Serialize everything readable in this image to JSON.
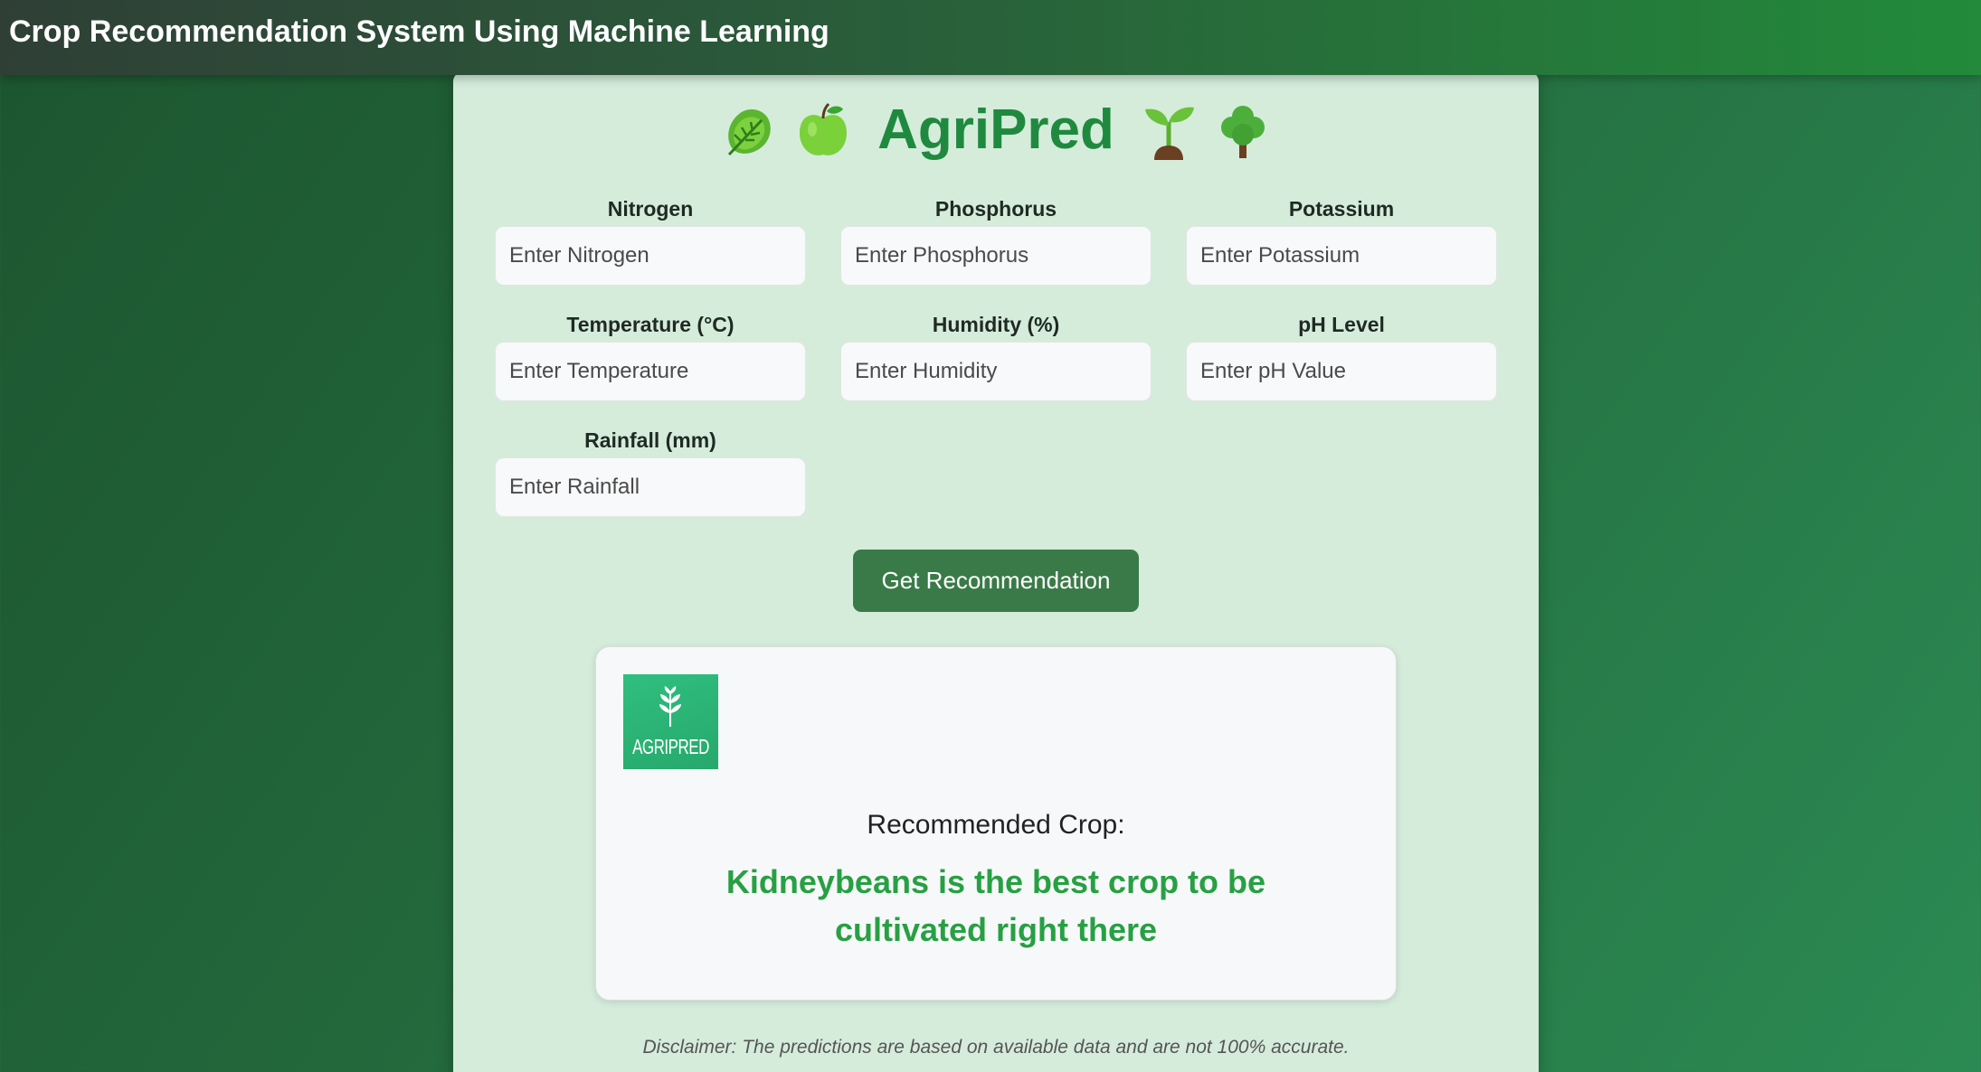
{
  "navbar": {
    "title": "Crop Recommendation System Using Machine Learning"
  },
  "brand": {
    "title": "AgriPred",
    "icons": [
      "leafy-green-icon",
      "green-apple-icon",
      "seedling-icon",
      "deciduous-tree-icon"
    ]
  },
  "form": {
    "fields": [
      {
        "label": "Nitrogen",
        "placeholder": "Enter Nitrogen"
      },
      {
        "label": "Phosphorus",
        "placeholder": "Enter Phosphorus"
      },
      {
        "label": "Potassium",
        "placeholder": "Enter Potassium"
      },
      {
        "label": "Temperature (°C)",
        "placeholder": "Enter Temperature"
      },
      {
        "label": "Humidity (%)",
        "placeholder": "Enter Humidity"
      },
      {
        "label": "pH Level",
        "placeholder": "Enter pH Value"
      },
      {
        "label": "Rainfall (mm)",
        "placeholder": "Enter Rainfall"
      }
    ],
    "submit_label": "Get Recommendation"
  },
  "result": {
    "logo_text": "AGRIPRED",
    "label": "Recommended Crop:",
    "value": "Kidneybeans is the best crop to be cultivated right there"
  },
  "disclaimer": "Disclaimer: The predictions are based on available data and are not 100% accurate.",
  "colors": {
    "brand_green": "#1f8a3f",
    "button": "#3a7a48",
    "result_text": "#27a043",
    "card_bg": "#d5ecdb"
  }
}
